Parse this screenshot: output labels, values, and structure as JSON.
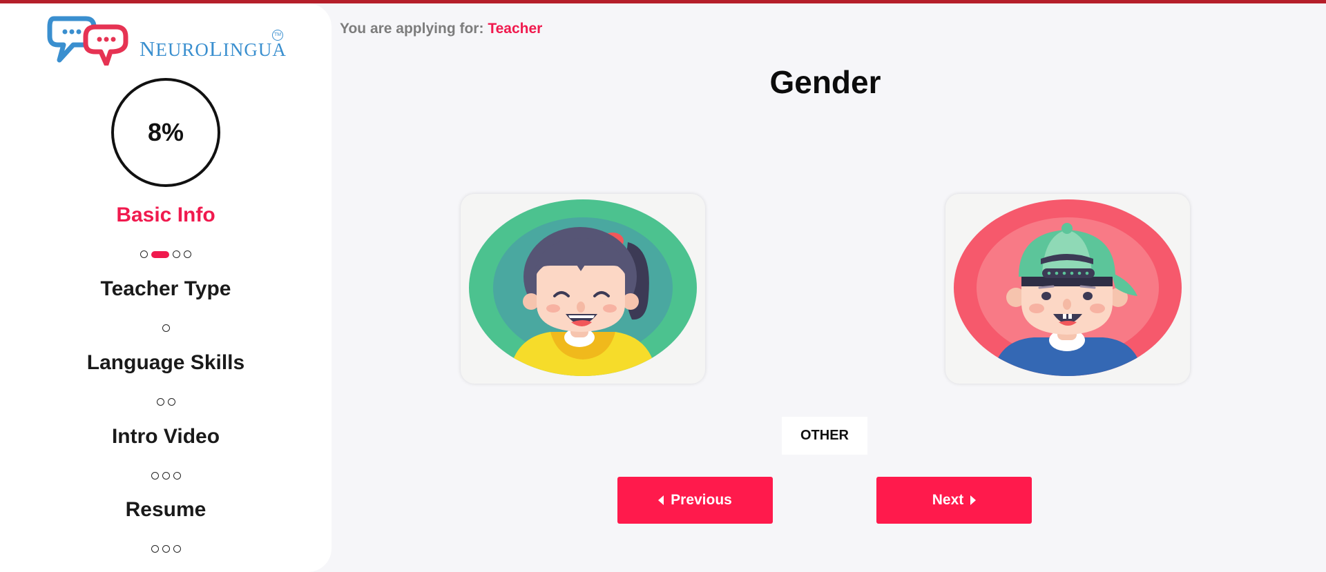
{
  "brand": {
    "name_prefix": "N",
    "name_rest": "EURO",
    "name_prefix2": "L",
    "name_rest2": "INGUA",
    "tm": "TM",
    "colors": {
      "blue": "#3a8fcf",
      "red": "#e63353"
    }
  },
  "progress": {
    "percent_label": "8%",
    "value": 0.08
  },
  "steps": [
    {
      "label": "Basic Info",
      "active": true,
      "dots": 4,
      "current_dot": 1
    },
    {
      "label": "Teacher Type",
      "active": false,
      "dots": 1
    },
    {
      "label": "Language Skills",
      "active": false,
      "dots": 2
    },
    {
      "label": "Intro Video",
      "active": false,
      "dots": 3
    },
    {
      "label": "Resume",
      "active": false,
      "dots": 3
    }
  ],
  "applying": {
    "prefix": "You are applying for:",
    "role": "Teacher"
  },
  "question": {
    "title": "Gender"
  },
  "options": {
    "female": {
      "icon": "girl-avatar-icon"
    },
    "male": {
      "icon": "boy-avatar-icon"
    },
    "other_label": "OTHER"
  },
  "nav": {
    "previous_label": "Previous",
    "next_label": "Next"
  },
  "colors": {
    "accent": "#ff1a4c",
    "active_text": "#f01a4e",
    "top_bar": "#b51f2a"
  }
}
